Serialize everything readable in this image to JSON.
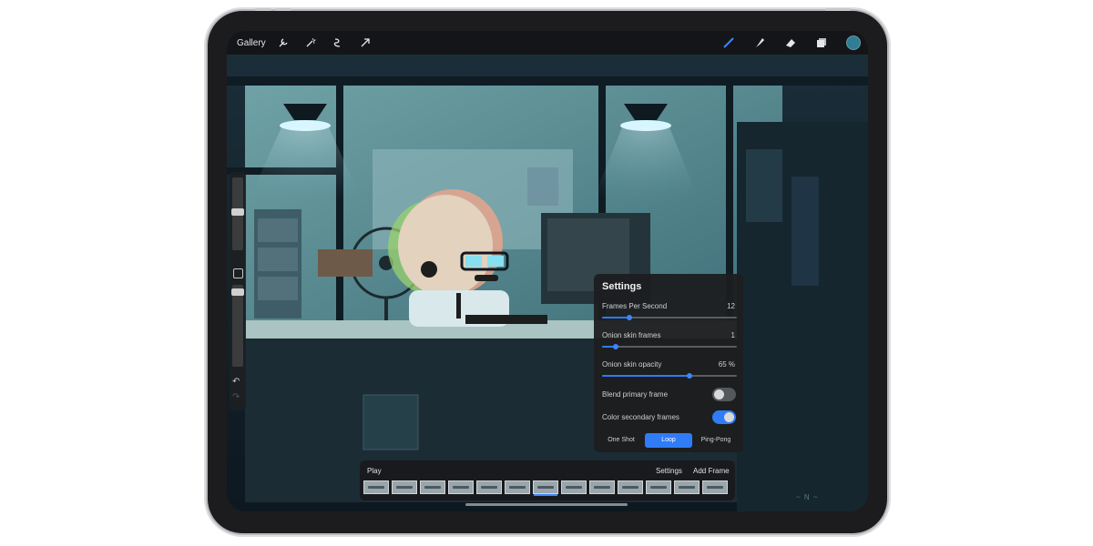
{
  "toolbar": {
    "gallery_label": "Gallery",
    "left_icons": [
      "wrench-icon",
      "magic-wand-icon",
      "selection-icon",
      "transform-arrow-icon"
    ],
    "right_icons": [
      "brush-icon",
      "smudge-icon",
      "eraser-icon",
      "layers-icon"
    ],
    "current_color": "#2f7e93"
  },
  "settings": {
    "title": "Settings",
    "frames_per_second": {
      "label": "Frames Per Second",
      "value": "12",
      "level": 0.2
    },
    "onion_skin_frames": {
      "label": "Onion skin frames",
      "value": "1",
      "level": 0.1
    },
    "onion_skin_opacity": {
      "label": "Onion skin opacity",
      "value": "65 %",
      "level": 0.65
    },
    "blend_primary_frame": {
      "label": "Blend primary frame",
      "on": false
    },
    "color_secondary_frames": {
      "label": "Color secondary frames",
      "on": true
    },
    "modes": [
      "One Shot",
      "Loop",
      "Ping-Pong"
    ],
    "active_mode": "Loop"
  },
  "timeline": {
    "play_label": "Play",
    "settings_label": "Settings",
    "add_frame_label": "Add Frame",
    "frame_count": 13,
    "current_frame": 7
  },
  "colors": {
    "accent": "#2f7cf6"
  }
}
